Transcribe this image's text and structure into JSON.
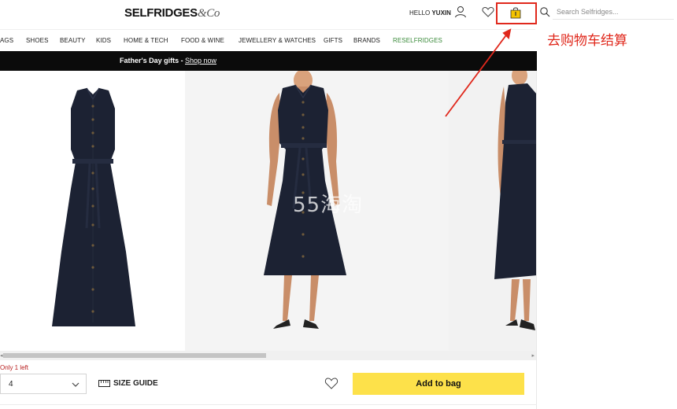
{
  "header": {
    "logo": "SELFRIDGES",
    "logo_amp": "&Co",
    "hello_prefix": "HELLO",
    "hello_name": "YUXIN",
    "search_placeholder": "Search Selfridges..."
  },
  "nav": {
    "items": [
      "AGS",
      "SHOES",
      "BEAUTY",
      "KIDS",
      "HOME & TECH",
      "FOOD & WINE",
      "JEWELLERY & WATCHES",
      "GIFTS",
      "BRANDS",
      "RESELFRIDGES"
    ]
  },
  "promo": {
    "text": "Father's Day gifts -",
    "link": "Shop now"
  },
  "annotation": {
    "text": "去购物车结算"
  },
  "watermark": "55海淘",
  "purchase": {
    "stock_note": "Only 1 left",
    "size_value": "4",
    "size_guide_label": "SIZE GUIDE",
    "add_to_bag_label": "Add to bag"
  },
  "colors": {
    "accent_yellow": "#fde14a",
    "annotation_red": "#e0281c",
    "stock_red": "#b81e1e",
    "resell_green": "#3a8a3a",
    "dress_navy": "#1c2233"
  },
  "icons": [
    "user-icon",
    "heart-icon",
    "shopping-bag-icon",
    "search-icon",
    "chevron-down-icon",
    "ruler-icon",
    "wishlist-heart-icon"
  ]
}
